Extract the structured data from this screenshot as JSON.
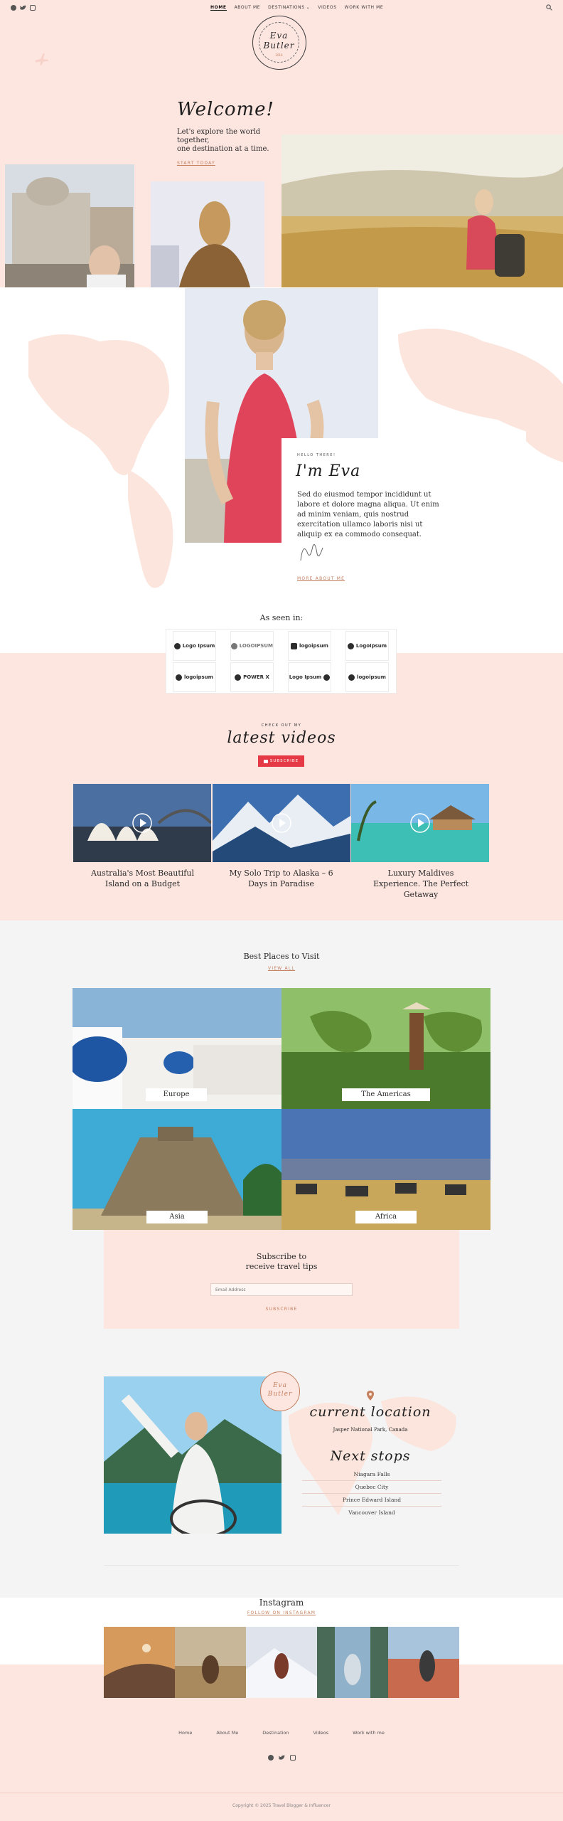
{
  "colors": {
    "pink": "#fde5e0",
    "accent": "#c47f5d",
    "red": "#e63946",
    "gray": "#f4f4f4"
  },
  "nav": {
    "social_icons": [
      "facebook-icon",
      "twitter-icon",
      "instagram-icon"
    ],
    "items": [
      "HOME",
      "ABOUT ME",
      "DESTINATIONS",
      "VIDEOS",
      "WORK WITH ME"
    ],
    "search_icon": "search-icon"
  },
  "logo": {
    "line1": "Eva",
    "line2": "Butler",
    "ring": "THE ADVENTURES OF A TRAVEL BLOGGER",
    "year": "2016"
  },
  "hero": {
    "welcome": "Welcome!",
    "tagline_1": "Let's explore the world together,",
    "tagline_2": "one destination at a time.",
    "cta": "START TODAY"
  },
  "about": {
    "eyebrow": "HELLO THERE!",
    "title": "I'm Eva",
    "body": "Sed do eiusmod tempor incididunt ut labore et dolore magna aliqua. Ut enim ad minim veniam, quis nostrud exercitation ullamco laboris nisi ut aliquip ex ea commodo consequat.",
    "cta": "MORE ABOUT ME"
  },
  "seen_in": {
    "title": "As seen in:",
    "logos": [
      "Logo Ipsum",
      "LOGOIPSUM",
      "logoipsum",
      "LogoIpsum",
      "logoipsum",
      "POWER X",
      "Logo Ipsum",
      "logoipsum"
    ]
  },
  "videos": {
    "eyebrow": "CHECK OUT MY",
    "title": "latest videos",
    "subscribe": "SUBSCRIBE",
    "items": [
      {
        "title": "Australia's Most Beautiful Island on a Budget"
      },
      {
        "title": "My Solo Trip to Alaska – 6 Days in Paradise"
      },
      {
        "title": "Luxury Maldives Experience. The Perfect Getaway"
      }
    ]
  },
  "places": {
    "title": "Best Places to Visit",
    "view_all": "VIEW ALL",
    "items": [
      "Europe",
      "The Americas",
      "Asia",
      "Africa"
    ]
  },
  "subscribe": {
    "title_1": "Subscribe to",
    "title_2": "receive travel tips",
    "placeholder": "Email Address",
    "button": "SUBSCRIBE"
  },
  "location": {
    "title": "current location",
    "place": "Jasper National Park, Canada",
    "next_title": "Next stops",
    "stops": [
      "Niagara Falls",
      "Quebec City",
      "Prince Edward Island",
      "Vancouver Island"
    ]
  },
  "instagram": {
    "title": "Instagram",
    "follow": "FOLLOW ON INSTAGRAM"
  },
  "footer": {
    "links": [
      "Home",
      "About Me",
      "Destination",
      "Videos",
      "Work with me"
    ],
    "copyright": "Copyright © 2025 Travel Blogger & Influencer"
  }
}
